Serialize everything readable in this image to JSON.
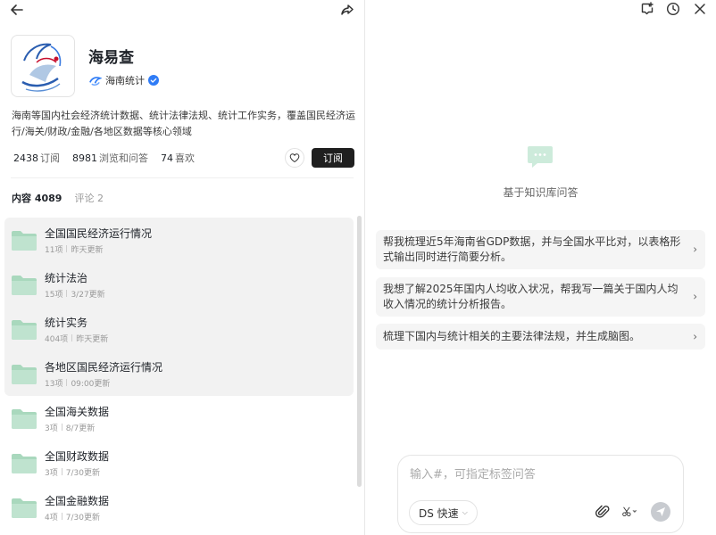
{
  "kb": {
    "title": "海易查",
    "org": "海南统计",
    "description": "海南等国内社会经济统计数据、统计法律法规、统计工作实务，覆盖国民经济运行/海关/财政/金融/各地区数据等核心领域",
    "stats": [
      {
        "num": "2438",
        "label": "订阅"
      },
      {
        "num": "8981",
        "label": "浏览和问答"
      },
      {
        "num": "74",
        "label": "喜欢"
      }
    ],
    "subscribe_label": "订阅"
  },
  "tabs": {
    "content": "内容 4089",
    "comments": "评论 2"
  },
  "folders": [
    {
      "title": "全国国民经济运行情况",
      "count": "11项",
      "updated": "昨天更新"
    },
    {
      "title": "统计法治",
      "count": "15项",
      "updated": "3/27更新"
    },
    {
      "title": "统计实务",
      "count": "404项",
      "updated": "昨天更新"
    },
    {
      "title": "各地区国民经济运行情况",
      "count": "13项",
      "updated": "09:00更新"
    },
    {
      "title": "全国海关数据",
      "count": "3项",
      "updated": "8/7更新"
    },
    {
      "title": "全国财政数据",
      "count": "3项",
      "updated": "7/30更新"
    },
    {
      "title": "全国金融数据",
      "count": "4项",
      "updated": "7/30更新"
    }
  ],
  "assistant": {
    "heading": "基于知识库问答",
    "suggestions": [
      "帮我梳理近5年海南省GDP数据，并与全国水平比对，以表格形式输出同时进行简要分析。",
      "我想了解2025年国内人均收入状况，帮我写一篇关于国内人均收入情况的统计分析报告。",
      "梳理下国内与统计相关的主要法律法规，并生成脑图。"
    ],
    "input_placeholder": "输入#，可指定标签问答",
    "model_label": "DS 快速"
  },
  "colors": {
    "folder": "#bfe3cf",
    "folder_tab": "#a9d8bd",
    "verified": "#2f7cf6",
    "subscribe_bg": "#1f1f1f"
  }
}
